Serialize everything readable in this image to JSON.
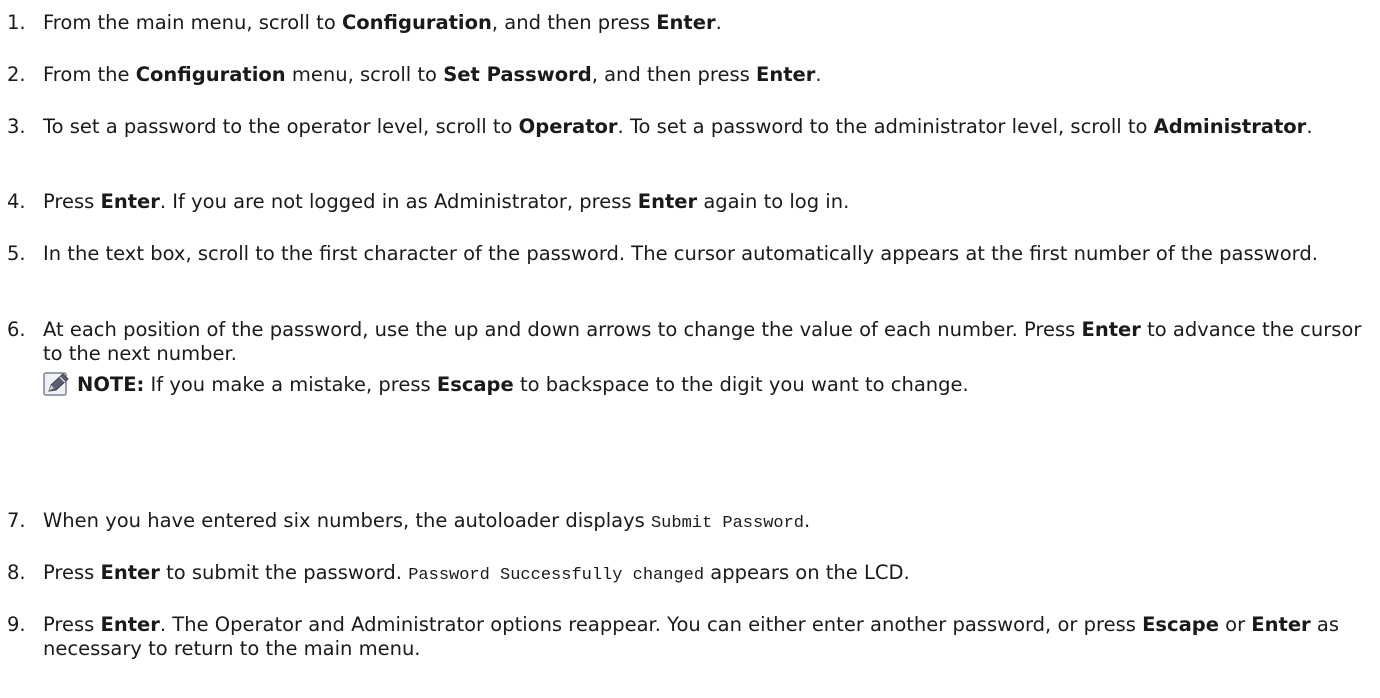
{
  "steps": [
    {
      "number": "1.",
      "parts": [
        "From the main menu, scroll to ",
        "Configuration",
        ", and then press ",
        "Enter",
        "."
      ]
    },
    {
      "number": "2.",
      "parts": [
        "From the ",
        "Configuration",
        " menu, scroll to ",
        "Set Password",
        ", and then press ",
        "Enter",
        "."
      ]
    },
    {
      "number": "3.",
      "parts": [
        "To set a password to the operator level, scroll to ",
        "Operator",
        ". To set a password to the administrator level, scroll to ",
        "Administrator",
        "."
      ]
    },
    {
      "number": "4.",
      "parts": [
        "Press ",
        "Enter",
        ". If you are not logged in as Administrator, press ",
        "Enter",
        " again to log in."
      ]
    },
    {
      "number": "5.",
      "parts": [
        "In the text box, scroll to the first character of the password. The cursor automatically appears at the first number of the password."
      ]
    },
    {
      "number": "6.",
      "parts": [
        "At each position of the password, use the up and down arrows to change the value of each number. Press ",
        "Enter",
        " to advance the cursor to the next number."
      ]
    },
    {
      "number": "7.",
      "parts": [
        "When you have entered six numbers, the autoloader displays ",
        "Submit Password",
        "."
      ]
    },
    {
      "number": "8.",
      "parts": [
        "Press ",
        "Enter",
        " to submit the password. ",
        "Password Successfully changed",
        " appears on the LCD."
      ]
    },
    {
      "number": "9.",
      "parts": [
        "Press ",
        "Enter",
        ". The Operator and Administrator options reappear. You can either enter another password, or press ",
        "Escape",
        " or ",
        "Enter",
        " as necessary to return to the main menu."
      ]
    }
  ],
  "note": {
    "icon": "note-pencil-icon",
    "label": "NOTE:",
    "parts": [
      " If you make a mistake, press ",
      "Escape",
      " to backspace to the digit you want to change."
    ]
  },
  "colors": {
    "text": "#1a1a1a",
    "icon_fill": "#5a6070"
  }
}
